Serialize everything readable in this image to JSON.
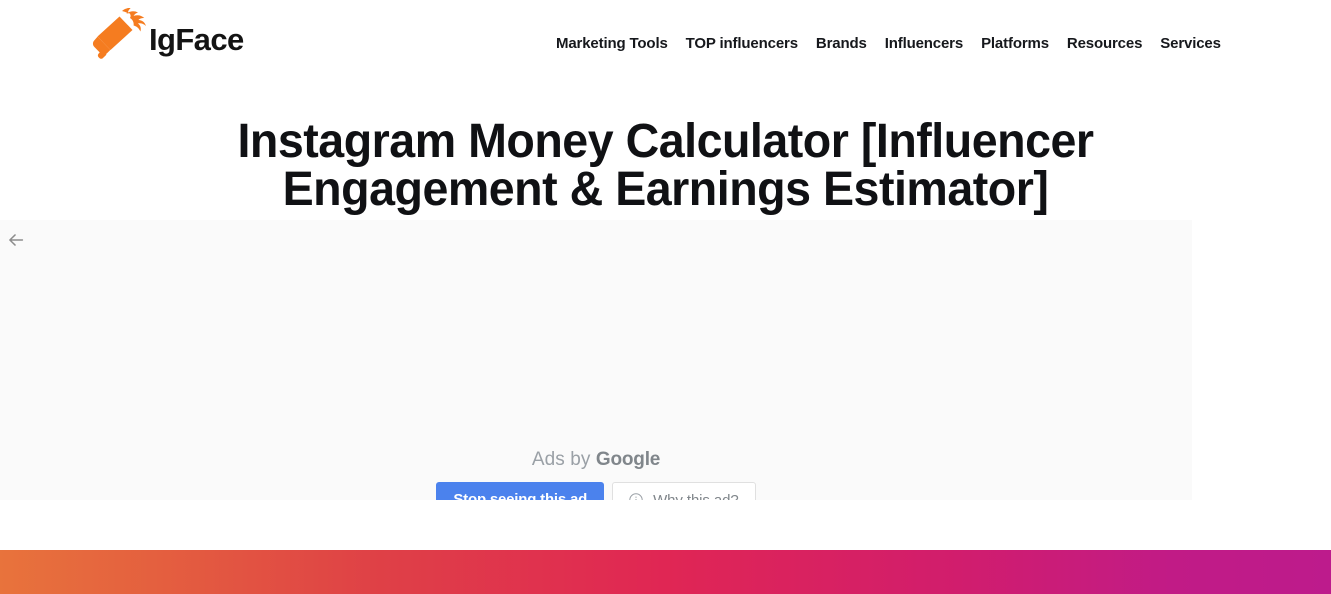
{
  "header": {
    "brand": {
      "name": "IgFace",
      "icon": "megaphone-icon",
      "color": "#F57C20"
    },
    "nav": [
      {
        "label": "Marketing Tools"
      },
      {
        "label": "TOP influencers"
      },
      {
        "label": "Brands"
      },
      {
        "label": "Influencers"
      },
      {
        "label": "Platforms"
      },
      {
        "label": "Resources"
      },
      {
        "label": "Services"
      }
    ]
  },
  "main": {
    "page_title": "Instagram Money Calculator [Influencer\nEngagement & Earnings Estimator]"
  },
  "ad_overlay": {
    "back_icon": "arrow-left-icon",
    "byline_prefix": "Ads by ",
    "byline_brand": "Google",
    "stop_button_label": "Stop seeing this ad",
    "why_button_label": "Why this ad?",
    "why_button_icon": "info-circle-icon",
    "stop_button_color": "#4B82ED",
    "background_color": "#FAFAFA"
  },
  "footer_band": {
    "gradient_start": "#E8733C",
    "gradient_mid": "#E02654",
    "gradient_end": "#BD1B8C"
  }
}
